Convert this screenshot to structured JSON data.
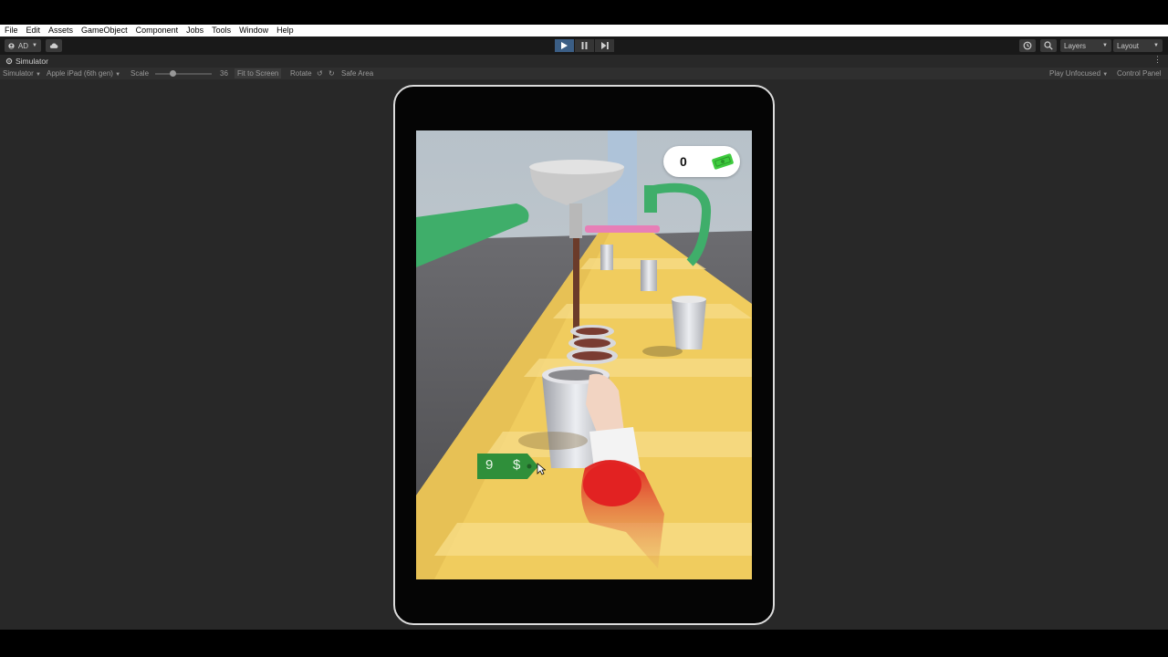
{
  "menu": {
    "items": [
      "File",
      "Edit",
      "Assets",
      "GameObject",
      "Component",
      "Jobs",
      "Tools",
      "Window",
      "Help"
    ]
  },
  "toolbar": {
    "account_label": "AD",
    "cloud_icon": "cloud-icon",
    "play_icon": "play-icon",
    "pause_icon": "pause-icon",
    "step_icon": "step-icon",
    "history_icon": "history-icon",
    "search_icon": "search-icon",
    "layers_label": "Layers",
    "layout_label": "Layout"
  },
  "tab": {
    "title": "Simulator"
  },
  "simulator_bar": {
    "mode_label": "Simulator",
    "device_label": "Apple iPad (6th gen)",
    "scale_label": "Scale",
    "scale_value": "36",
    "fit_label": "Fit to Screen",
    "rotate_label": "Rotate",
    "safe_area_label": "Safe Area",
    "focus_label": "Play Unfocused",
    "control_panel_label": "Control Panel"
  },
  "game": {
    "money_count": "0",
    "price_value": "9",
    "price_currency": "$"
  },
  "colors": {
    "play_active": "#3b5e85",
    "money_green": "#3ecb3e",
    "tag_green": "#2f8f3a",
    "track_yellow": "#f3cf62",
    "pipe_green": "#3fae6a"
  }
}
